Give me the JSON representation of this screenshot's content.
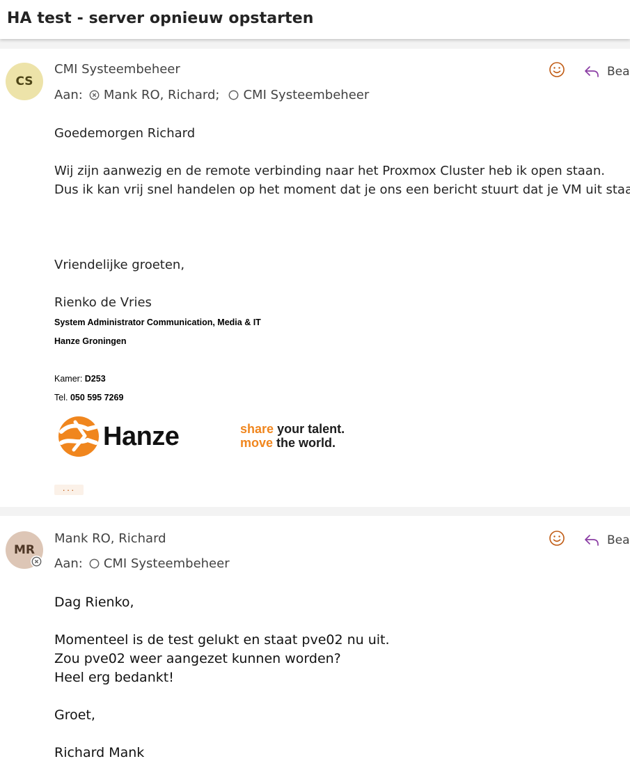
{
  "subject": "HA test - server opnieuw opstarten",
  "colors": {
    "accent": "#c05a12",
    "reply_icon": "#8a3ca3",
    "avatar_cs": "#ede3a9",
    "avatar_mr": "#ddc6b6"
  },
  "messages": [
    {
      "avatar_initials": "CS",
      "sender": "CMI Systeembeheer",
      "to_label": "Aan:",
      "recipients": [
        "Mank RO, Richard;",
        "CMI Systeembeheer"
      ],
      "reply_label": "Bea",
      "body": {
        "greeting": "Goedemorgen Richard",
        "line1": "Wij zijn aanwezig en de remote verbinding naar het Proxmox Cluster heb ik open staan.",
        "line2": "Dus ik kan vrij snel handelen op het moment dat je ons een bericht stuurt dat je VM uit staat.",
        "closing": "Vriendelijke groeten,",
        "name": "Rienko de Vries",
        "role": "System Administrator Communication, Media & IT",
        "org": "Hanze Groningen",
        "room_label": "Kamer:",
        "room": "D253",
        "tel_label": "Tel.",
        "tel": "050 595 7269",
        "logo_text": "Hanze",
        "slogan_1a": "share",
        "slogan_1b": "your talent.",
        "slogan_2a": "move",
        "slogan_2b": "the world."
      },
      "more_label": "···"
    },
    {
      "avatar_initials": "MR",
      "sender": "Mank RO, Richard",
      "to_label": "Aan:",
      "recipients": [
        "CMI Systeembeheer"
      ],
      "reply_label": "Bea",
      "body": {
        "greeting": "Dag Rienko,",
        "line1": "Momenteel is de test gelukt en staat pve02 nu uit.",
        "line2": "Zou pve02 weer aangezet kunnen worden?",
        "line3": "Heel erg bedankt!",
        "closing": "Groet,",
        "name": "Richard Mank"
      }
    }
  ]
}
